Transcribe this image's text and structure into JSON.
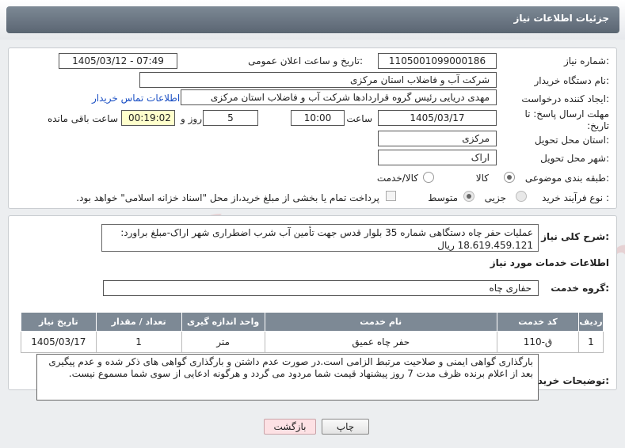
{
  "header": {
    "title": "جزئیات اطلاعات نیاز"
  },
  "form": {
    "need_number_label": "شماره نیاز:",
    "need_number": "1105001099000186",
    "announce_label": "تاریخ و ساعت اعلان عمومی:",
    "announce_value": "1405/03/12 - 07:49",
    "buyer_org_label": "نام دستگاه خریدار:",
    "buyer_org": "شرکت آب و فاضلاب استان مرکزی",
    "creator_label": "ایجاد کننده درخواست:",
    "creator": "مهدی دریایی رئیس گروه قراردادها شرکت آب و فاضلاب استان مرکزی",
    "contact_link": "اطلاعات تماس خریدار",
    "deadline_label": "مهلت ارسال پاسخ: تا تاریخ:",
    "deadline_date": "1405/03/17",
    "time_label": "ساعت",
    "deadline_time": "10:00",
    "days_value": "5",
    "days_label": "روز و",
    "remaining_time": "00:19:02",
    "remaining_label": "ساعت باقی مانده",
    "province_label": "استان محل تحویل:",
    "province": "مرکزی",
    "city_label": "شهر محل تحویل:",
    "city": "اراک",
    "category_label": "طبقه بندی موضوعی:",
    "category_options": [
      "کالا",
      "کالا/خدمت"
    ],
    "purchase_type_label": "نوع فرآیند خرید :",
    "purchase_options": [
      "جزیی",
      "متوسط"
    ],
    "treasury_text": "پرداخت تمام یا بخشی از مبلغ خرید،از محل \"اسناد خزانه اسلامی\" خواهد بود."
  },
  "summary": {
    "label": "شرح کلی نیاز:",
    "text": "عملیات حفر چاه دستگاهی شماره 35 بلوار قدس جهت تأمین آب شرب اضطراری شهر اراک-مبلغ براورد: 18.619.459.121 ریال"
  },
  "services": {
    "section_title": "اطلاعات خدمات مورد نیاز",
    "group_label": "گروه خدمت:",
    "group_value": "حفاری چاه",
    "columns": [
      "ردیف",
      "کد خدمت",
      "نام خدمت",
      "واحد اندازه گیری",
      "تعداد / مقدار",
      "تاریخ نیاز"
    ],
    "rows": [
      {
        "index": "1",
        "code": "ق-110",
        "name": "حفر چاه عمیق",
        "unit": "متر",
        "qty": "1",
        "date": "1405/03/17"
      }
    ]
  },
  "notes": {
    "label": "توضیحات خریدار:",
    "text": "بارگذاری گواهی ایمنی و صلاحیت مرتبط الزامی است.در صورت عدم داشتن و بارگذاری گواهی های ذکر شده و عدم پیگیری بعد از اعلام برنده ظرف مدت 7 روز پیشنهاد قیمت شما مردود می گردد و هرگونه ادعایی از سوی شما مسموع نیست."
  },
  "buttons": {
    "print": "چاپ",
    "back": "بازگشت"
  },
  "watermark": {
    "text": "AriaTender.net"
  }
}
